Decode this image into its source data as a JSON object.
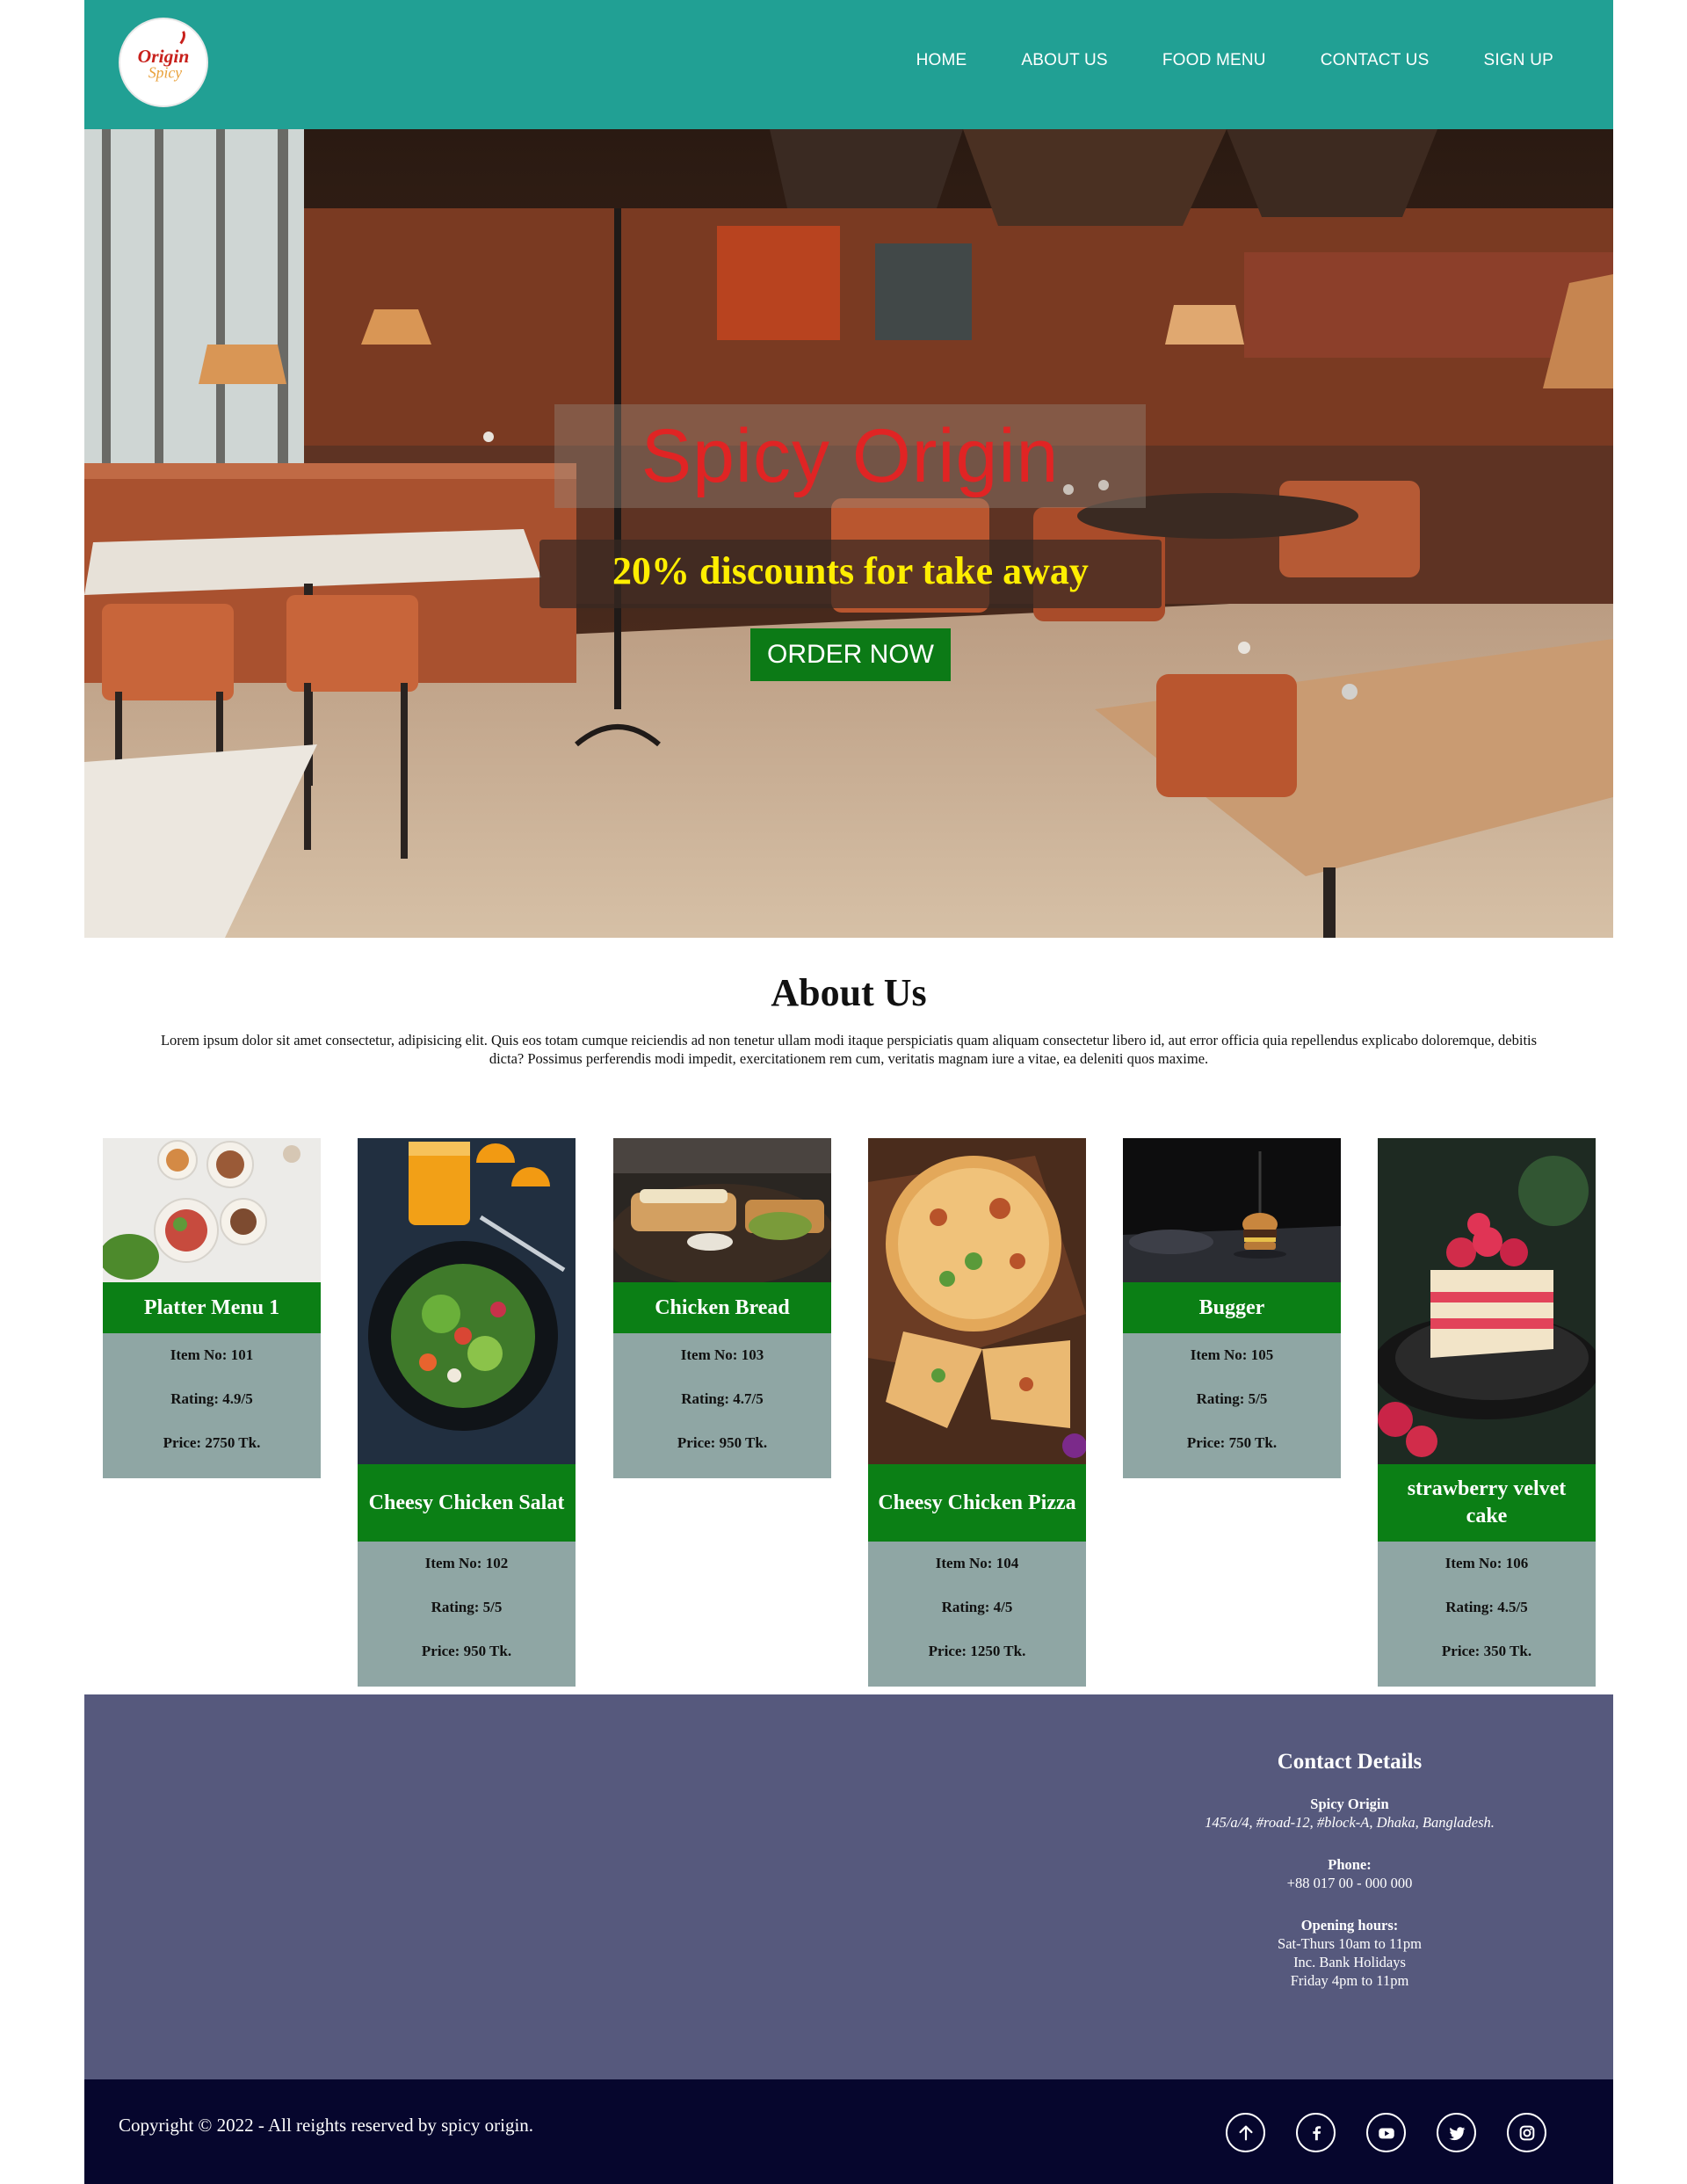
{
  "brand": {
    "logo_text_top": "Origin",
    "logo_text_bottom": "Spicy"
  },
  "nav": {
    "items": [
      "HOME",
      "ABOUT US",
      "FOOD MENU",
      "CONTACT US",
      "SIGN UP"
    ]
  },
  "hero": {
    "title": "Spicy Origin",
    "subtitle": "20% discounts for take away",
    "cta": "ORDER NOW"
  },
  "about": {
    "title": "About Us",
    "text": "Lorem ipsum dolor sit amet consectetur, adipisicing elit. Quis eos totam cumque reiciendis ad non tenetur ullam modi itaque perspiciatis quam aliquam consectetur libero id, aut error officia quia repellendus explicabo doloremque, debitis dicta? Possimus perferendis modi impedit, exercitationem rem cum, veritatis magnam iure a vitae, ea deleniti quos maxime."
  },
  "menu": [
    {
      "name": "Platter Menu 1",
      "item": "Item No: 101",
      "rating": "Rating: 4.9/5",
      "price": "Price: 2750 Tk."
    },
    {
      "name": "Cheesy Chicken Salat",
      "item": "Item No: 102",
      "rating": "Rating: 5/5",
      "price": "Price: 950 Tk."
    },
    {
      "name": "Chicken Bread",
      "item": "Item No: 103",
      "rating": "Rating: 4.7/5",
      "price": "Price: 950 Tk."
    },
    {
      "name": "Cheesy Chicken Pizza",
      "item": "Item No: 104",
      "rating": "Rating: 4/5",
      "price": "Price: 1250 Tk."
    },
    {
      "name": "Bugger",
      "item": "Item No: 105",
      "rating": "Rating: 5/5",
      "price": "Price: 750 Tk."
    },
    {
      "name": "strawberry velvet cake",
      "item": "Item No: 106",
      "rating": "Rating: 4.5/5",
      "price": "Price: 350 Tk."
    }
  ],
  "contact": {
    "title": "Contact Details",
    "name": "Spicy Origin",
    "address": "145/a/4, #road-12, #block-A, Dhaka, Bangladesh.",
    "phone_label": "Phone:",
    "phone": "+88 017 00 - 000 000",
    "hours_label": "Opening hours:",
    "hours_1": "Sat-Thurs 10am to 11pm",
    "hours_2": "Inc. Bank Holidays",
    "hours_3": "Friday 4pm to 11pm"
  },
  "footer": {
    "copyright": "Copyright © 2022 - All reights reserved by spicy origin."
  },
  "icons": [
    "arrow-up-icon",
    "facebook-icon",
    "youtube-icon",
    "twitter-icon",
    "instagram-icon"
  ],
  "colors": {
    "header": "#21a094",
    "card_title": "#0b7f15",
    "card_info": "#8fa6a4",
    "footer": "#56597d",
    "bottom_bar": "#06062d",
    "hero_title": "#e02424",
    "hero_subtitle": "#ffee00",
    "cta": "#0c7a16"
  }
}
